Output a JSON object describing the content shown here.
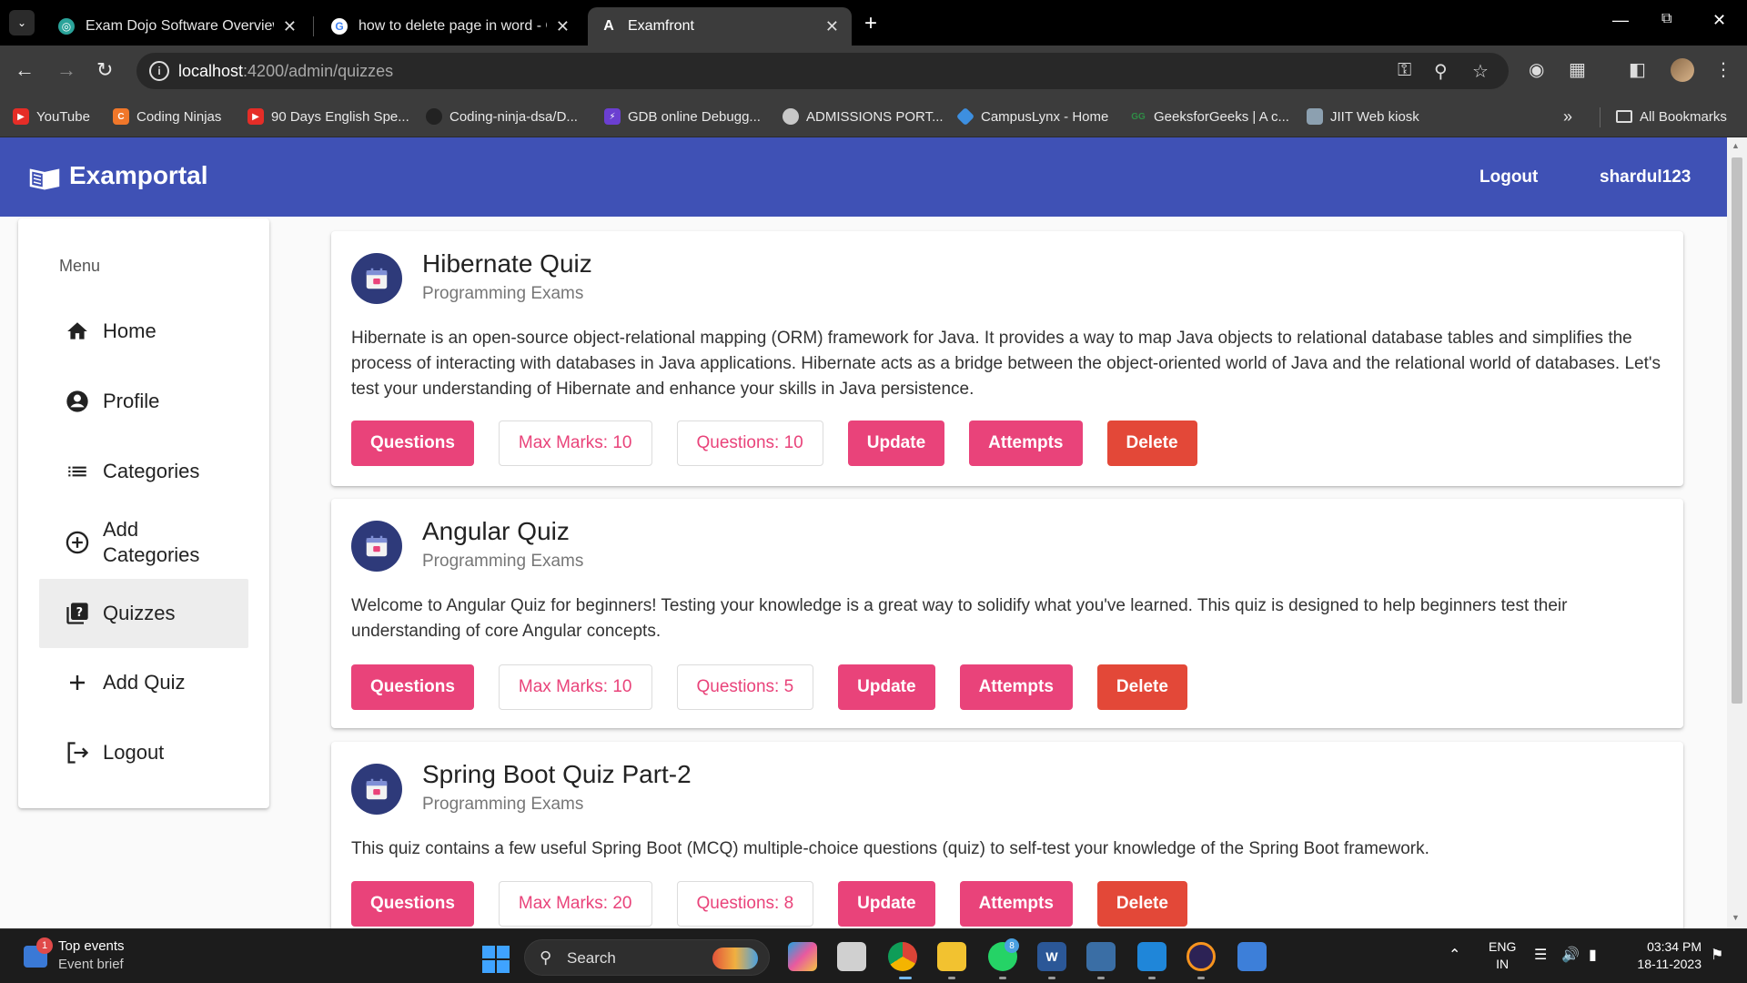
{
  "browser": {
    "tabs": [
      {
        "label": "Exam Dojo Software Overview",
        "active": false
      },
      {
        "label": "how to delete page in word - G",
        "active": false
      },
      {
        "label": "Examfront",
        "active": true
      }
    ],
    "url_host": "localhost",
    "url_path": ":4200/admin/quizzes",
    "bookmarks": [
      {
        "label": "YouTube",
        "icon": "youtube-icon",
        "color": "#e52d27"
      },
      {
        "label": "Coding Ninjas",
        "icon": "coding-ninjas-icon",
        "color": "#f0772a"
      },
      {
        "label": "90 Days English Spe...",
        "icon": "youtube-icon",
        "color": "#e52d27"
      },
      {
        "label": "Coding-ninja-dsa/D...",
        "icon": "github-icon",
        "color": "#222222"
      },
      {
        "label": "GDB online Debugg...",
        "icon": "gdb-icon",
        "color": "#6b3fd1"
      },
      {
        "label": "ADMISSIONS PORT...",
        "icon": "globe-icon",
        "color": "#c8c8c8"
      },
      {
        "label": "CampusLynx - Home",
        "icon": "campuslynx-icon",
        "color": "#3d8fe0"
      },
      {
        "label": "GeeksforGeeks | A c...",
        "icon": "gfg-icon",
        "color": "#2f8d46"
      },
      {
        "label": "JIIT Web kiosk",
        "icon": "kiosk-icon",
        "color": "#8ca0b0"
      }
    ],
    "all_bookmarks": "All Bookmarks"
  },
  "header": {
    "title": "Examportal",
    "logout": "Logout",
    "username": "shardul123"
  },
  "sidebar": {
    "heading": "Menu",
    "items": [
      {
        "label": "Home",
        "icon": "home-icon"
      },
      {
        "label": "Profile",
        "icon": "account-circle-icon"
      },
      {
        "label": "Categories",
        "icon": "list-icon"
      },
      {
        "label": "Add\nCategories",
        "icon": "add-circle-icon"
      },
      {
        "label": "Quizzes",
        "icon": "quiz-icon",
        "active": true
      },
      {
        "label": "Add Quiz",
        "icon": "plus-icon"
      },
      {
        "label": "Logout",
        "icon": "logout-icon"
      }
    ]
  },
  "quizzes": [
    {
      "title": "Hibernate Quiz",
      "category": "Programming Exams",
      "description": "Hibernate is an open-source object-relational mapping (ORM) framework for Java. It provides a way to map Java objects to relational database tables and simplifies the process of interacting with databases in Java applications. Hibernate acts as a bridge between the object-oriented world of Java and the relational world of databases. Let's test your understanding of Hibernate and enhance your skills in Java persistence.",
      "questions_btn": "Questions",
      "max_marks": "Max Marks: 10",
      "question_count": "Questions: 10",
      "update_btn": "Update",
      "attempts_btn": "Attempts",
      "delete_btn": "Delete"
    },
    {
      "title": "Angular Quiz",
      "category": "Programming Exams",
      "description": "Welcome to Angular Quiz for beginners! Testing your knowledge is a great way to solidify what you've learned. This quiz is designed to help beginners test their understanding of core Angular concepts.",
      "questions_btn": "Questions",
      "max_marks": "Max Marks: 10",
      "question_count": "Questions: 5",
      "update_btn": "Update",
      "attempts_btn": "Attempts",
      "delete_btn": "Delete"
    },
    {
      "title": "Spring Boot Quiz Part-2",
      "category": "Programming Exams",
      "description": "This quiz contains a few useful Spring Boot (MCQ) multiple-choice questions (quiz) to self-test your knowledge of the Spring Boot framework.",
      "questions_btn": "Questions",
      "max_marks": "Max Marks: 20",
      "question_count": "Questions: 8",
      "update_btn": "Update",
      "attempts_btn": "Attempts",
      "delete_btn": "Delete"
    }
  ],
  "taskbar": {
    "news_badge": "1",
    "news_title": "Top events",
    "news_subtitle": "Event brief",
    "search_label": "Search",
    "whatsapp_badge": "8",
    "lang_1": "ENG",
    "lang_2": "IN",
    "time": "03:34 PM",
    "date": "18-11-2023"
  },
  "colors": {
    "primary": "#3f51b5",
    "accent": "#e9437a",
    "warn": "#e34838"
  }
}
